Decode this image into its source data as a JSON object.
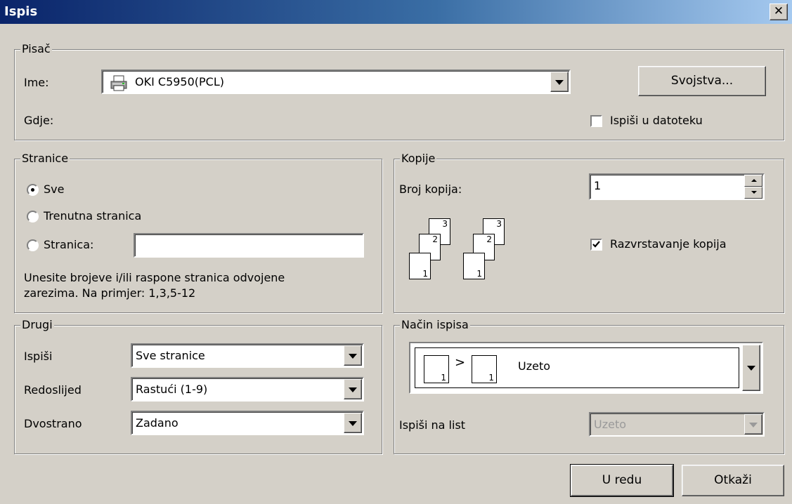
{
  "window": {
    "title": "Ispis"
  },
  "printer": {
    "legend": "Pisač",
    "name_label": "Ime:",
    "name_value": "OKI C5950(PCL)",
    "where_label": "Gdje:",
    "properties_button": "Svojstva...",
    "print_to_file_label": "Ispiši u datoteku",
    "print_to_file_checked": false
  },
  "pages": {
    "legend": "Stranice",
    "options": [
      "Sve",
      "Trenutna stranica",
      "Stranica:"
    ],
    "selected": "Sve",
    "hint_line1": "Unesite brojeve i/ili raspone stranica odvojene",
    "hint_line2": "zarezima. Na primjer: 1,3,5-12"
  },
  "copies": {
    "legend": "Kopije",
    "count_label": "Broj kopija:",
    "count_value": "1",
    "collate_label": "Razvrstavanje kopija",
    "collate_checked": true,
    "collate_pages": [
      "1",
      "2",
      "3",
      "1",
      "2",
      "3"
    ]
  },
  "other": {
    "legend": "Drugi",
    "print_label": "Ispiši",
    "print_value": "Sve stranice",
    "order_label": "Redoslijed",
    "order_value": "Rastući (1-9)",
    "duplex_label": "Dvostrano",
    "duplex_value": "Zadano"
  },
  "mode": {
    "legend": "Način ispisa",
    "preview_page_a": "1",
    "preview_page_b": "1",
    "preview_arrow": ">",
    "mode_value": "Uzeto",
    "per_sheet_label": "Ispiši na list",
    "per_sheet_value": "Uzeto"
  },
  "actions": {
    "ok": "U redu",
    "cancel": "Otkaži"
  }
}
